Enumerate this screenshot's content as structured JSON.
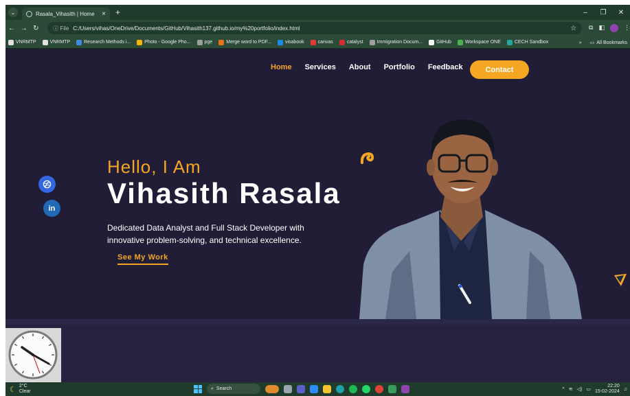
{
  "browser": {
    "tab_title": "Rasala_Vihasith | Home",
    "address_prefix": "File",
    "url": "C:/Users/vihas/OneDrive/Documents/GitHub/Vihasith137.github.io/my%20portfolio/index.html",
    "bookmarks": [
      {
        "label": "VNRMTP",
        "color": "#e0e0e0"
      },
      {
        "label": "VNRMTP",
        "color": "#e0e0e0"
      },
      {
        "label": "Research Methods i...",
        "color": "#3c8dde"
      },
      {
        "label": "Photo - Google Pho...",
        "color": "#f4b400"
      },
      {
        "label": "pge",
        "color": "#9e9e9e"
      },
      {
        "label": "Merge word to PDF...",
        "color": "#e8711a"
      },
      {
        "label": "visabook",
        "color": "#1e88e5"
      },
      {
        "label": "canvas",
        "color": "#e53935"
      },
      {
        "label": "catalyst",
        "color": "#d32f2f"
      },
      {
        "label": "Immigration Docum...",
        "color": "#9e9e9e"
      },
      {
        "label": "GitHub",
        "color": "#f5f5f5"
      },
      {
        "label": "Workspace ONE",
        "color": "#4caf50"
      },
      {
        "label": "CECH Sandbox",
        "color": "#26a69a"
      }
    ],
    "bookmarks_more": "»",
    "all_bookmarks": "All Bookmarks"
  },
  "site": {
    "nav": [
      "Home",
      "Services",
      "About",
      "Portfolio",
      "Feedback"
    ],
    "contact_label": "Contact",
    "greeting": "Hello, I Am",
    "name": "Vihasith Rasala",
    "description": "Dedicated Data Analyst and Full Stack Developer with innovative problem-solving, and technical excellence.",
    "cta": "See My Work",
    "social": {
      "dribbble": "⚽",
      "linkedin": "in"
    },
    "accent_color": "#f5a623",
    "background_color": "#211d37"
  },
  "taskbar": {
    "temperature": "2°C",
    "condition": "Clear",
    "search_placeholder": "Search",
    "time": "22:20",
    "date": "15-02-2024"
  }
}
